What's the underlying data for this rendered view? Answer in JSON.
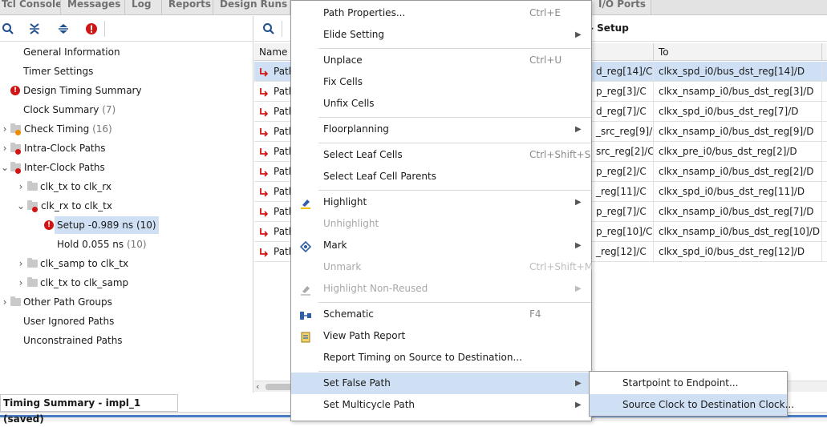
{
  "tabs": [
    {
      "label": "Tcl Console"
    },
    {
      "label": "Messages"
    },
    {
      "label": "Log"
    },
    {
      "label": "Reports"
    },
    {
      "label": "Design Runs"
    },
    {
      "label": "I/O Ports"
    }
  ],
  "tree": {
    "items": [
      {
        "label": "General Information",
        "count": ""
      },
      {
        "label": "Timer Settings",
        "count": ""
      },
      {
        "label": "Design Timing Summary",
        "count": ""
      },
      {
        "label": "Clock Summary",
        "count": "(7)"
      },
      {
        "label": "Check Timing",
        "count": "(16)"
      },
      {
        "label": "Intra-Clock Paths",
        "count": ""
      },
      {
        "label": "Inter-Clock Paths",
        "count": ""
      },
      {
        "label": "clk_tx to clk_rx",
        "count": ""
      },
      {
        "label": "clk_rx to clk_tx",
        "count": ""
      },
      {
        "label": "Setup -0.989 ns",
        "count": "(10)"
      },
      {
        "label": "Hold 0.055 ns",
        "count": "(10)"
      },
      {
        "label": "clk_samp to clk_tx",
        "count": ""
      },
      {
        "label": "clk_tx to clk_samp",
        "count": ""
      },
      {
        "label": "Other Path Groups",
        "count": ""
      },
      {
        "label": "User Ignored Paths",
        "count": ""
      },
      {
        "label": "Unconstrained Paths",
        "count": ""
      }
    ]
  },
  "status_tab": "Timing Summary - impl_1 (saved)",
  "table": {
    "title_fragment": "- Setup",
    "headers": {
      "name": "Name",
      "to": "To"
    },
    "rows": [
      {
        "name": "Path",
        "from": "d_reg[14]/C",
        "to": "clkx_spd_i0/bus_dst_reg[14]/D"
      },
      {
        "name": "Path",
        "from": "p_reg[3]/C",
        "to": "clkx_nsamp_i0/bus_dst_reg[3]/D"
      },
      {
        "name": "Path",
        "from": "d_reg[7]/C",
        "to": "clkx_spd_i0/bus_dst_reg[7]/D"
      },
      {
        "name": "Path",
        "from": "_src_reg[9]/C",
        "to": "clkx_nsamp_i0/bus_dst_reg[9]/D"
      },
      {
        "name": "Path",
        "from": "src_reg[2]/C",
        "to": "clkx_pre_i0/bus_dst_reg[2]/D"
      },
      {
        "name": "Path",
        "from": "p_reg[2]/C",
        "to": "clkx_nsamp_i0/bus_dst_reg[2]/D"
      },
      {
        "name": "Path",
        "from": "_reg[11]/C",
        "to": "clkx_spd_i0/bus_dst_reg[11]/D"
      },
      {
        "name": "Path",
        "from": "p_reg[7]/C",
        "to": "clkx_nsamp_i0/bus_dst_reg[7]/D"
      },
      {
        "name": "Path",
        "from": "p_reg[10]/C",
        "to": "clkx_nsamp_i0/bus_dst_reg[10]/D"
      },
      {
        "name": "Path",
        "from": "_reg[12]/C",
        "to": "clkx_spd_i0/bus_dst_reg[12]/D"
      }
    ]
  },
  "menu": {
    "path_properties": {
      "label": "Path Properties...",
      "shortcut": "Ctrl+E"
    },
    "elide_setting": {
      "label": "Elide Setting"
    },
    "unplace": {
      "label": "Unplace",
      "shortcut": "Ctrl+U"
    },
    "fix_cells": {
      "label": "Fix Cells"
    },
    "unfix_cells": {
      "label": "Unfix Cells"
    },
    "floorplanning": {
      "label": "Floorplanning"
    },
    "select_leaf_cells": {
      "label": "Select Leaf Cells",
      "shortcut": "Ctrl+Shift+S"
    },
    "select_leaf_cell_parents": {
      "label": "Select Leaf Cell Parents"
    },
    "highlight": {
      "label": "Highlight"
    },
    "unhighlight": {
      "label": "Unhighlight"
    },
    "mark": {
      "label": "Mark"
    },
    "unmark": {
      "label": "Unmark",
      "shortcut": "Ctrl+Shift+M"
    },
    "highlight_non_reused": {
      "label": "Highlight Non-Reused"
    },
    "schematic": {
      "label": "Schematic",
      "shortcut": "F4"
    },
    "view_path_report": {
      "label": "View Path Report"
    },
    "report_timing": {
      "label": "Report Timing on Source to Destination..."
    },
    "set_false_path": {
      "label": "Set False Path"
    },
    "set_multicycle_path": {
      "label": "Set Multicycle Path"
    }
  },
  "submenu": {
    "startpoint_to_endpoint": "Startpoint to Endpoint...",
    "source_to_destination": "Source Clock to Destination Clock..."
  },
  "colors": {
    "accent_selection": "#cfe0f5",
    "error_red": "#d21414",
    "status_bar_blue": "#4a7cc4"
  }
}
